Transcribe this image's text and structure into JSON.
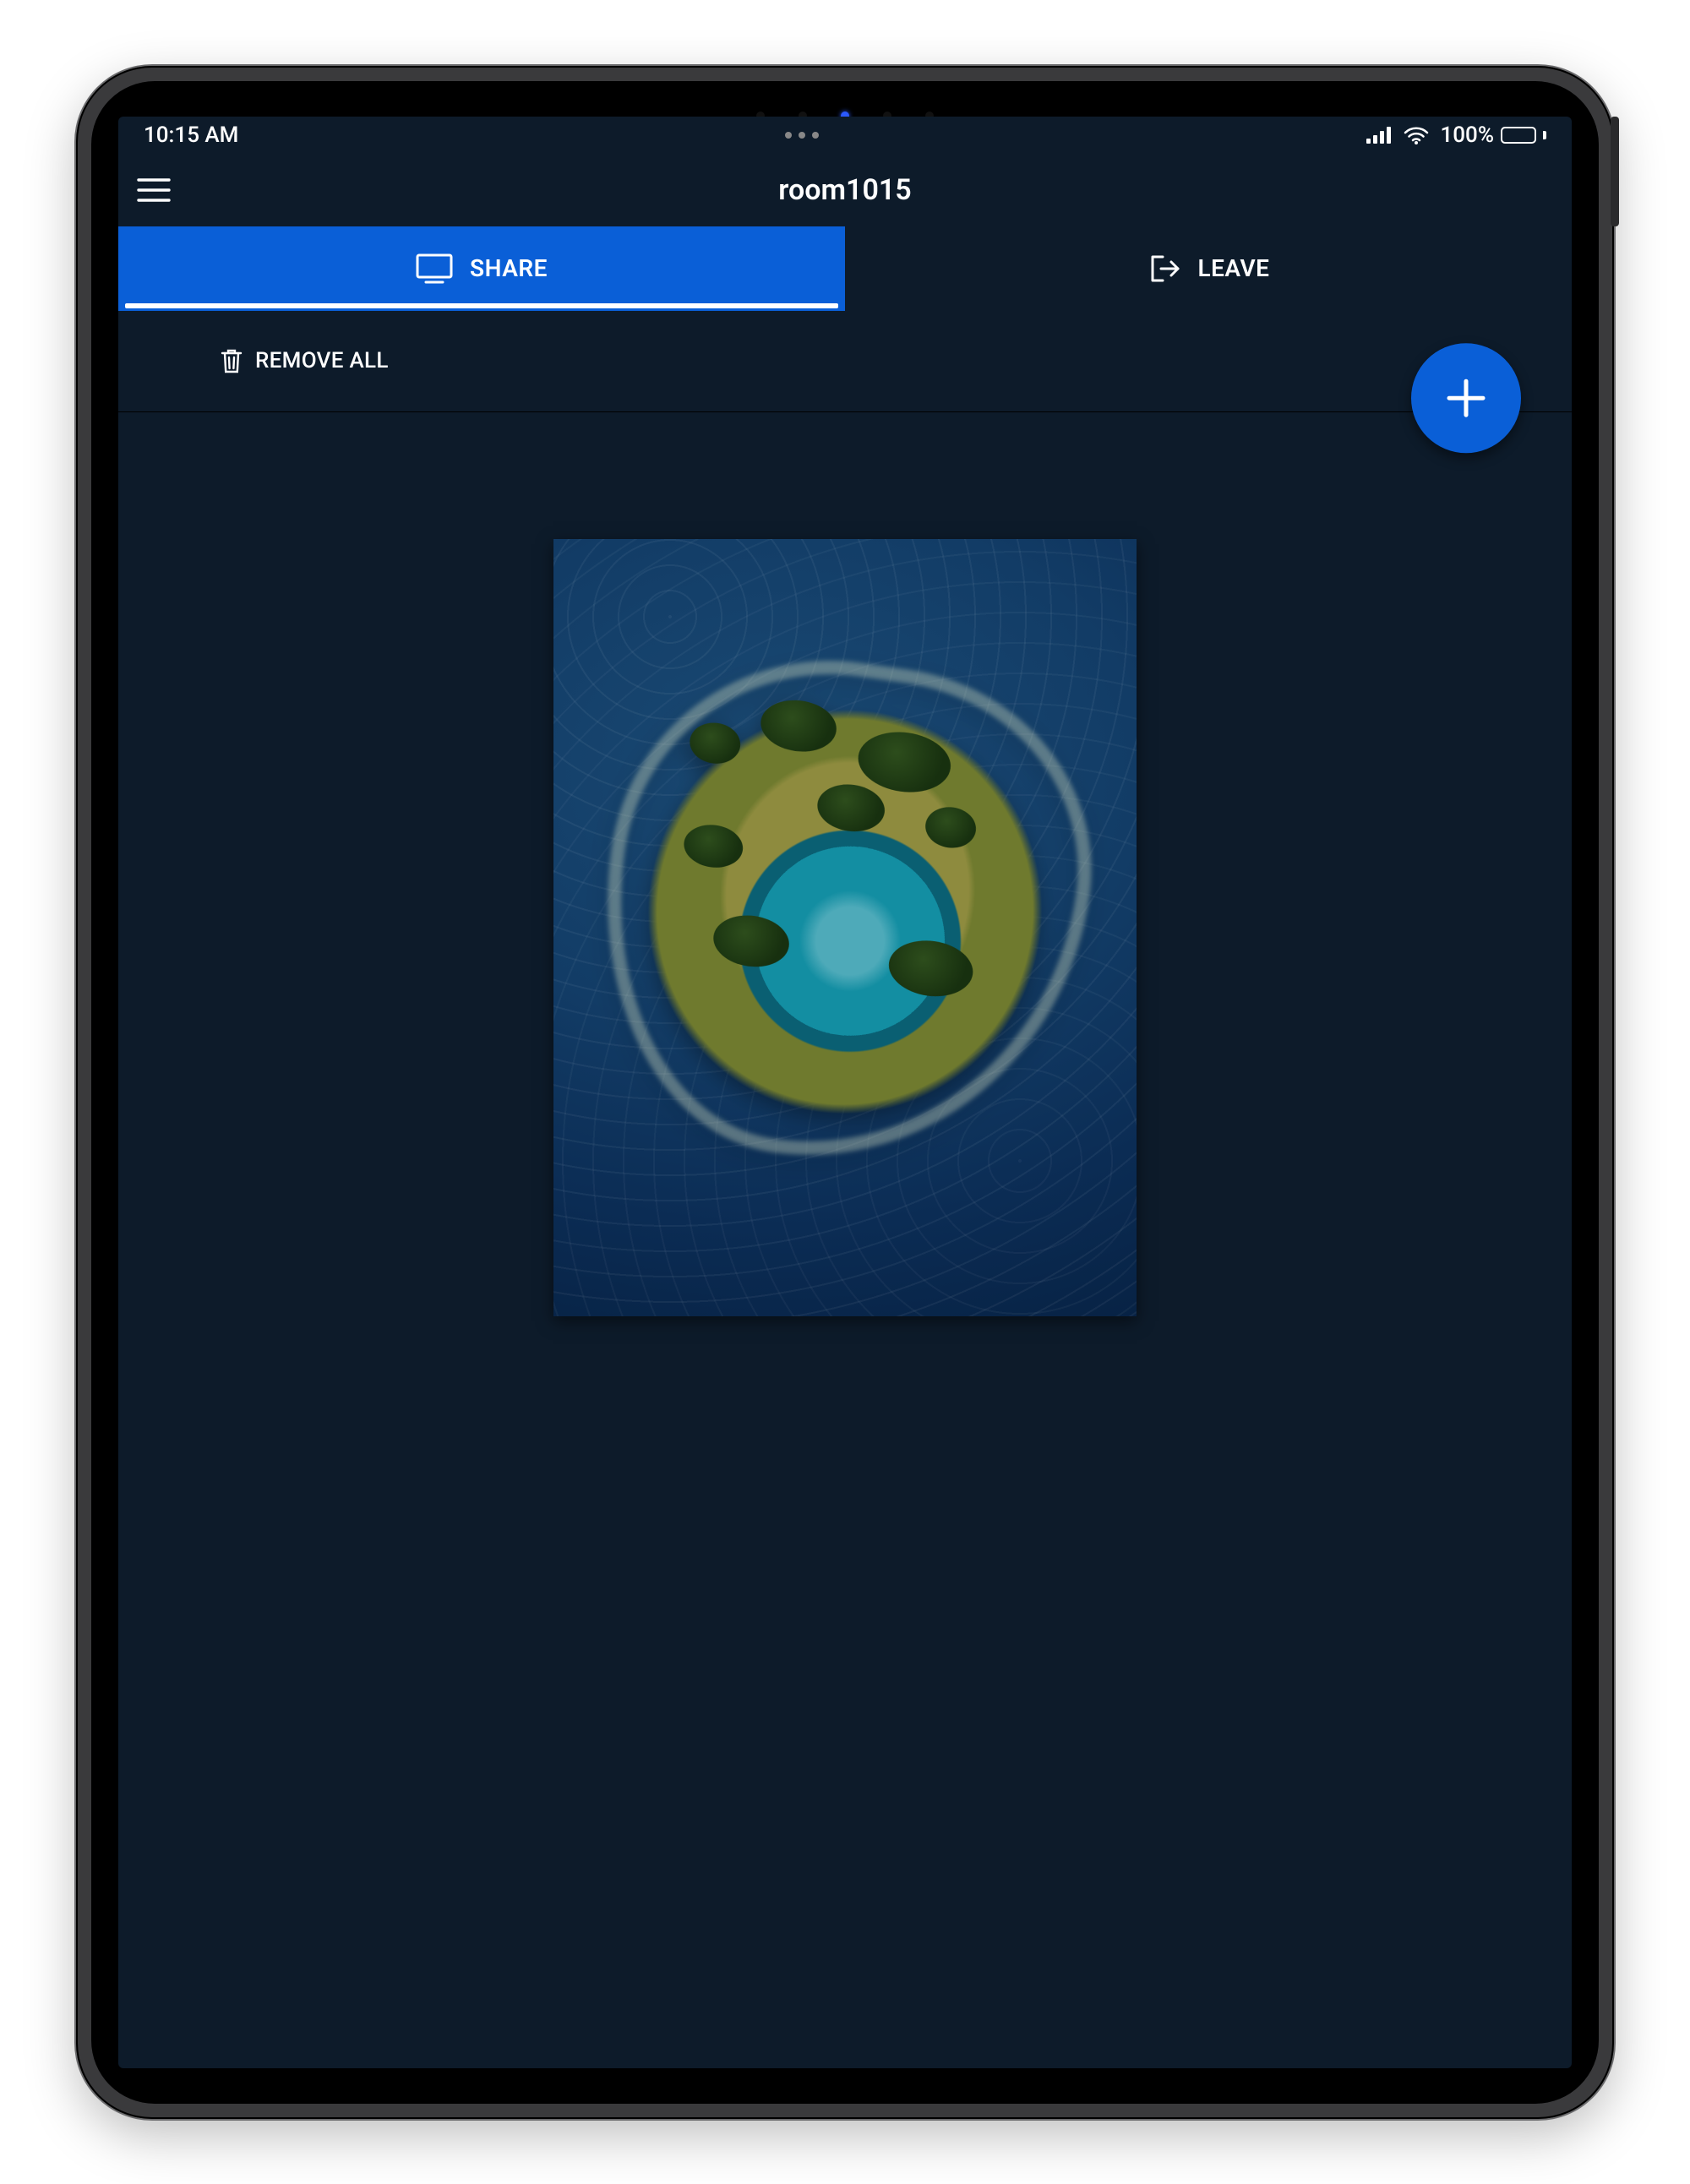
{
  "status": {
    "time": "10:15 AM",
    "battery_text": "100%"
  },
  "header": {
    "title": "room1015"
  },
  "tabs": {
    "share_label": "SHARE",
    "leave_label": "LEAVE"
  },
  "toolbar": {
    "remove_all_label": "REMOVE ALL"
  },
  "fab": {
    "icon_name": "plus-icon"
  },
  "content": {
    "media_alt": "aerial-island-photo"
  }
}
